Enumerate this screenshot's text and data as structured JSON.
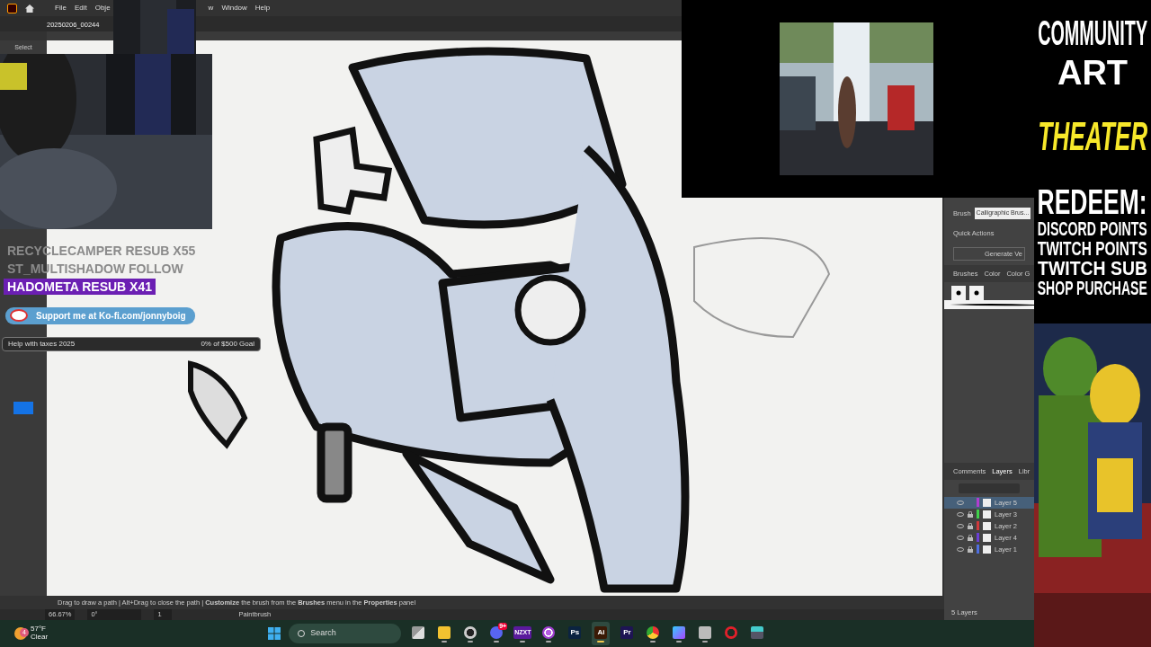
{
  "app": {
    "menu": [
      "File",
      "Edit",
      "Obje",
      "w",
      "Window",
      "Help"
    ],
    "document_tab": "20250206_00244",
    "tool_label": "Select",
    "status": {
      "hint": "Drag to draw a path  |  Alt+Drag to close the path  |  **Customize** the brush from the **Brushes** menu in the **Properties** panel",
      "zoom": "66.67%",
      "rotation": "0°",
      "artboard": "1",
      "tool": "Paintbrush"
    }
  },
  "properties": {
    "brush_label": "Brush",
    "brush_value": "Calligraphic Brus...",
    "quick_actions": "Quick Actions",
    "generate": "Generate Ve",
    "tabs": [
      {
        "label": "Brushes",
        "selected": false
      },
      {
        "label": "Color",
        "selected": false
      },
      {
        "label": "Color G",
        "selected": false
      }
    ]
  },
  "layers_panel": {
    "tabs": [
      {
        "label": "Comments",
        "selected": false
      },
      {
        "label": "Layers",
        "selected": true
      },
      {
        "label": "Libr",
        "selected": false
      }
    ],
    "layers": [
      {
        "name": "Layer 5",
        "color": "#b13ed0",
        "locked": false,
        "selected": true
      },
      {
        "name": "Layer 3",
        "color": "#3fd24a",
        "locked": true,
        "selected": false
      },
      {
        "name": "Layer 2",
        "color": "#d0393c",
        "locked": true,
        "selected": false
      },
      {
        "name": "Layer 4",
        "color": "#6b3fd6",
        "locked": true,
        "selected": false
      },
      {
        "name": "Layer 1",
        "color": "#4f6fe0",
        "locked": true,
        "selected": false
      }
    ],
    "count": "5 Layers"
  },
  "overlay": {
    "alerts": [
      {
        "text": "RECYCLECAMPER  RESUB X55",
        "highlighted": false
      },
      {
        "text": "ST_MULTISHADOW  FOLLOW",
        "highlighted": false
      },
      {
        "text": "HADOMETA  RESUB X41",
        "highlighted": true
      }
    ],
    "kofi": "Support me at Ko-fi.com/jonnyboig",
    "goal": {
      "label": "Help with taxes 2025",
      "progress": "0% of $500 Goal",
      "level": 0
    }
  },
  "promo": [
    {
      "text": "COMMUNITY",
      "kind": "title",
      "color": "#ffffff"
    },
    {
      "text": "ART",
      "kind": "title",
      "color": "#ffffff"
    },
    {
      "text": "THEATER",
      "kind": "feature",
      "color": "#f7e82a"
    },
    {
      "text": "REDEEM:",
      "kind": "title",
      "color": "#ffffff"
    },
    {
      "text": "DISCORD POINTS",
      "kind": "item",
      "color": "#ffffff"
    },
    {
      "text": "TWITCH POINTS",
      "kind": "item",
      "color": "#ffffff"
    },
    {
      "text": "TWITCH SUB",
      "kind": "item",
      "color": "#ffffff"
    },
    {
      "text": "SHOP PURCHASE",
      "kind": "item",
      "color": "#ffffff"
    }
  ],
  "taskbar": {
    "weather": {
      "badge": "4",
      "temp": "57°F",
      "condition": "Clear"
    },
    "search": "Search",
    "apps": [
      {
        "kind": "taskview",
        "running": false,
        "active": false
      },
      {
        "kind": "folder",
        "running": true,
        "active": false
      },
      {
        "kind": "obs",
        "running": true,
        "active": false
      },
      {
        "kind": "discord",
        "label": "9+",
        "running": true,
        "active": false
      },
      {
        "kind": "tile",
        "label": "NZXT",
        "running": true,
        "active": false,
        "color": "#5a1a9c"
      },
      {
        "kind": "ring",
        "running": true,
        "active": false
      },
      {
        "kind": "tile",
        "label": "Ps",
        "running": false,
        "active": false,
        "color": "#0b2340"
      },
      {
        "kind": "tile",
        "label": "Ai",
        "running": true,
        "active": true,
        "color": "#3a1a06"
      },
      {
        "kind": "tile",
        "label": "Pr",
        "running": false,
        "active": false,
        "color": "#1e1454"
      },
      {
        "kind": "chrome",
        "running": true,
        "active": false
      },
      {
        "kind": "diamond",
        "running": true,
        "active": false
      },
      {
        "kind": "robot",
        "running": true,
        "active": false
      },
      {
        "kind": "opera",
        "running": false,
        "active": false
      },
      {
        "kind": "screen",
        "running": false,
        "active": false
      }
    ]
  }
}
